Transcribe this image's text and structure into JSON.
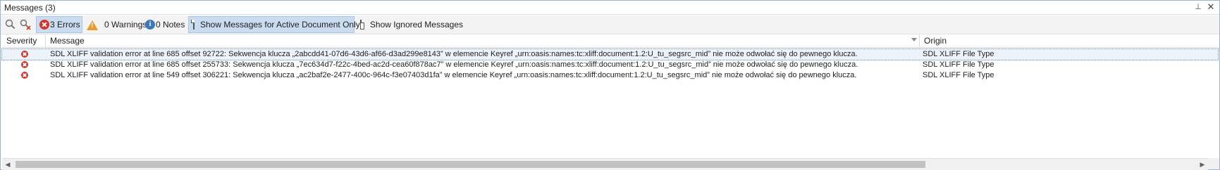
{
  "window": {
    "title": "Messages (3)",
    "pin_glyph": "⊥",
    "close_glyph": "✕"
  },
  "toolbar": {
    "errors_label": "3 Errors",
    "warnings_label": "0 Warnings",
    "notes_label": "0 Notes",
    "active_doc_label": "Show Messages for Active Document Only",
    "ignored_label": "Show Ignored Messages",
    "icons": {
      "filter": "filter-clear-icon",
      "clear": "clear-messages-icon",
      "error": "error-icon",
      "warning": "warning-icon",
      "info": "info-icon",
      "document": "document-icon"
    }
  },
  "grid": {
    "columns": [
      "Severity",
      "Message",
      "Origin"
    ],
    "rows": [
      {
        "severity": "error",
        "message": "SDL XLIFF validation error at line 685 offset 92722: Sekwencja klucza „2abcdd41-07d6-43d6-af66-d3ad299e8143” w elemencie Keyref „urn:oasis:names:tc:xliff:document:1.2:U_tu_segsrc_mid” nie może odwołać się do pewnego klucza.",
        "origin": "SDL XLIFF File Type"
      },
      {
        "severity": "error",
        "message": "SDL XLIFF validation error at line 685 offset 255733: Sekwencja klucza „7ec634d7-f22c-4bed-ac2d-cea60f878ac7” w elemencie Keyref „urn:oasis:names:tc:xliff:document:1.2:U_tu_segsrc_mid” nie może odwołać się do pewnego klucza.",
        "origin": "SDL XLIFF File Type"
      },
      {
        "severity": "error",
        "message": "SDL XLIFF validation error at line 549 offset 306221: Sekwencja klucza „ac2baf2e-2477-400c-964c-f3e07403d1fa” w elemencie Keyref „urn:oasis:names:tc:xliff:document:1.2:U_tu_segsrc_mid” nie może odwołać się do pewnego klucza.",
        "origin": "SDL XLIFF File Type"
      }
    ]
  },
  "colors": {
    "error": "#d1352b",
    "warning": "#e89a2a",
    "info": "#3a78b8",
    "active_toggle": "#c9dcf0",
    "selection": "#ecf3fb"
  }
}
